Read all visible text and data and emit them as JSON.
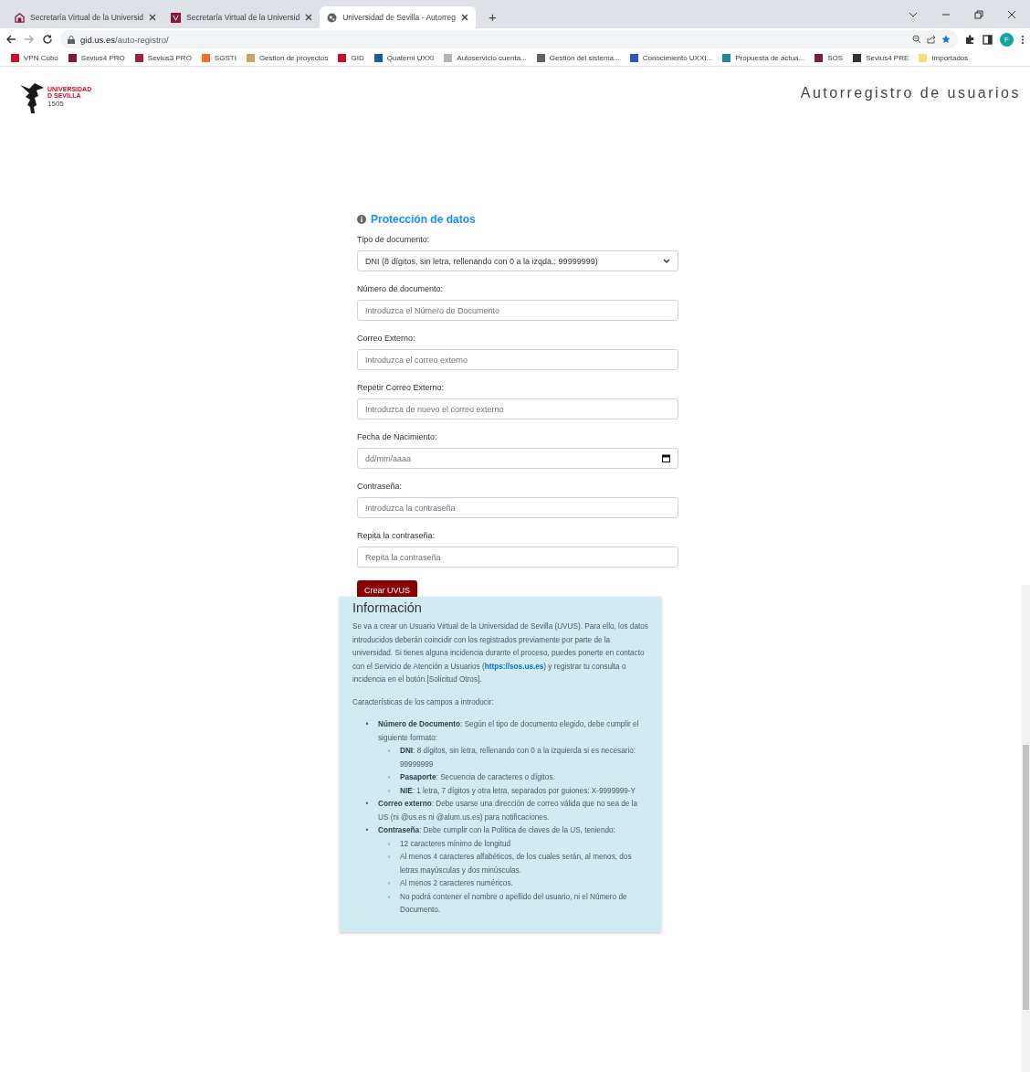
{
  "browser": {
    "tabs": [
      {
        "title": "Secretaría Virtual de la Universid",
        "selected": false
      },
      {
        "title": "Secretaría Virtual de la Universid",
        "selected": false
      },
      {
        "title": "Universidad de Sevilla - Autorreg",
        "selected": true
      }
    ],
    "new_tab": "+",
    "url_host": "gid.us.es",
    "url_path": "/auto-registro/",
    "avatar": "F",
    "bookmarks": [
      {
        "label": "VPN Cubo",
        "color": "#c8102e"
      },
      {
        "label": "Sevius4 PRO",
        "color": "#8b1538"
      },
      {
        "label": "Sevius3 PRO",
        "color": "#a0203a"
      },
      {
        "label": "SGSTI",
        "color": "#f36f21"
      },
      {
        "label": "Gestion de proyectos",
        "color": "#c9a36b"
      },
      {
        "label": "GID",
        "color": "#c8102e"
      },
      {
        "label": "Quaterni UXXI",
        "color": "#1a5aa6"
      },
      {
        "label": "Autoservicio cuenta...",
        "color": "#b0b4b8"
      },
      {
        "label": "Gestión del sistema...",
        "color": "#5f6368"
      },
      {
        "label": "Conocimiento UXXI...",
        "color": "#2b57c4"
      },
      {
        "label": "Propuesta de actua...",
        "color": "#1e8a8a"
      },
      {
        "label": "SOS",
        "color": "#7a1a4a"
      },
      {
        "label": "Sevius4 PRE",
        "color": "#333333"
      },
      {
        "label": "Importados",
        "color": "#f7dc7a"
      }
    ]
  },
  "header": {
    "logo_line1": "UNIVERSIDAD",
    "logo_line2": "D SEVILLA",
    "logo_year": "1505",
    "title": "Autorregistro de usuarios"
  },
  "form": {
    "privacy_link": "Protección de datos",
    "fields": [
      {
        "kind": "select",
        "label": "Tipo de documento:",
        "value": "DNI (8 dígitos, sin letra, rellenando con 0 a la izqda.: 99999999)"
      },
      {
        "kind": "text",
        "label": "Número de documento:",
        "placeholder": "Introduzca el Número de Documento"
      },
      {
        "kind": "text",
        "label": "Correo Externo:",
        "placeholder": "Introduzca el correo externo"
      },
      {
        "kind": "text",
        "label": "Repetir Correo Externo:",
        "placeholder": "Introduzca de nuevo el correo externo"
      },
      {
        "kind": "date",
        "label": "Fecha de Nacimiento:",
        "placeholder": "dd/mm/aaaa"
      },
      {
        "kind": "text",
        "label": "Contraseña:",
        "placeholder": "Introduzca la contraseña"
      },
      {
        "kind": "text",
        "label": "Repita la contraseña:",
        "placeholder": "Repita la contraseña"
      }
    ],
    "submit": "Crear UVUS"
  },
  "info": {
    "title": "Información",
    "intro_before": "Se va a crear un Usuario Virtual de la Universidad de Sevilla (UVUS). Para ello, los datos introducidos deberán coincidir con los registrados previamente por parte de la universidad. Si tienes alguna incidencia durante el proceso, puedes ponerte en contacto con el Servicio de Atención a Usuarios (",
    "intro_link": "https://sos.us.es",
    "intro_after": ") y registrar tu consulta o incidencia en el botón [Solicitud Otros].",
    "fields_heading": "Características de los campos a introducir:",
    "items": [
      {
        "marker": "•",
        "text": "**Número de Documento**: Según el tipo de documento elegido, debe cumplir el siguiente formato:",
        "children": [
          {
            "marker": "◦",
            "text": "**DNI**: 8 dígitos, sin letra, rellenando con 0 a la izquierda si es necesario: 99999999"
          },
          {
            "marker": "◦",
            "text": "**Pasaporte**: Secuencia de caracteres o dígitos."
          },
          {
            "marker": "◦",
            "text": "**NIE**: 1 letra, 7 dígitos y otra letra, separados por guiones: X-9999999-Y"
          }
        ]
      },
      {
        "marker": "•",
        "text": "**Correo externo**: Debe usarse una dirección de correo válida que no sea de la US (ni @us.es ni @alum.us.es) para notificaciones."
      },
      {
        "marker": "•",
        "text": "**Contraseña**: Debe cumplir con la Política de claves de la US, teniendo:",
        "children": [
          {
            "marker": "◦",
            "text": "12 caracteres mínimo de longitud"
          },
          {
            "marker": "◦",
            "text": "Al menos 4 caracteres alfabéticos, de los cuales serán, al menos, dos letras mayúsculas y dos minúsculas."
          },
          {
            "marker": "◦",
            "text": "Al menos 2 caracteres numéricos."
          },
          {
            "marker": "◦",
            "text": "No podrá contener el nombre o apellido del usuario, ni el Número de Documento."
          }
        ]
      }
    ]
  }
}
